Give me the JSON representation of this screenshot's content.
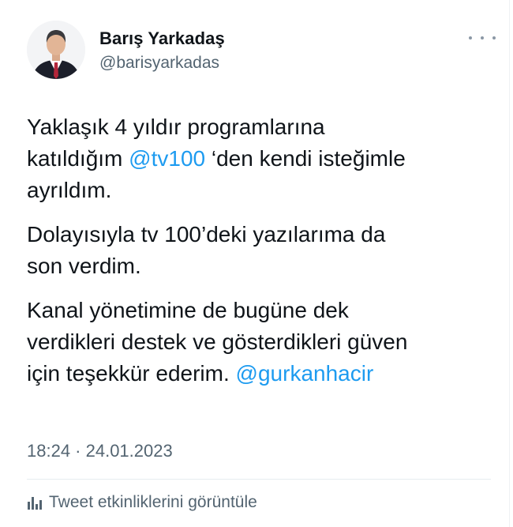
{
  "author": {
    "display_name": "Barış Yarkadaş",
    "handle": "@barisyarkadas",
    "avatar_icon": "profile-photo-icon"
  },
  "tweet": {
    "p1_line1": "Yaklaşık 4 yıldır programlarına",
    "p1_pre": "katıldığım ",
    "p1_mention": "@tv100",
    "p1_post": " ‘den kendi isteğimle",
    "p1_line3": "ayrıldım.",
    "p2_line1": "Dolayısıyla tv 100’deki yazılarıma da",
    "p2_line2": "son verdim.",
    "p3_line1": "Kanal yönetimine de bugüne dek",
    "p3_line2": "verdikleri destek ve gösterdikleri güven",
    "p3_pre": "için teşekkür ederim. ",
    "p3_mention": "@gurkanhacir"
  },
  "timestamp": "18:24 · 24.01.2023",
  "analytics": {
    "label": "Tweet etkinliklerini görüntüle",
    "icon": "analytics-bar-chart-icon"
  },
  "more_menu_icon": "more-dots-icon",
  "colors": {
    "text_primary": "#0f1419",
    "text_secondary": "#536471",
    "link": "#1d9bf0",
    "divider": "#e6ecf0"
  }
}
